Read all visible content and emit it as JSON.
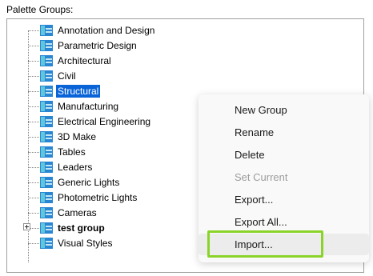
{
  "heading": "Palette Groups:",
  "tree": {
    "items": [
      {
        "label": "Annotation and Design"
      },
      {
        "label": "Parametric Design"
      },
      {
        "label": "Architectural"
      },
      {
        "label": "Civil"
      },
      {
        "label": "Structural",
        "selected": true
      },
      {
        "label": "Manufacturing"
      },
      {
        "label": "Electrical Engineering"
      },
      {
        "label": "3D Make"
      },
      {
        "label": "Tables"
      },
      {
        "label": "Leaders"
      },
      {
        "label": "Generic Lights"
      },
      {
        "label": "Photometric Lights"
      },
      {
        "label": "Cameras"
      },
      {
        "label": "test group",
        "bold": true,
        "expandable": true
      },
      {
        "label": "Visual Styles"
      }
    ]
  },
  "context_menu": {
    "items": [
      {
        "label": "New Group"
      },
      {
        "label": "Rename"
      },
      {
        "label": "Delete"
      },
      {
        "label": "Set Current",
        "disabled": true
      },
      {
        "label": "Export..."
      },
      {
        "label": "Export All..."
      },
      {
        "label": "Import...",
        "hovered": true
      }
    ]
  },
  "colors": {
    "selection": "#0a64d8",
    "highlight_outline": "#8ad32a",
    "icon_blue": "#1e8fd8",
    "icon_teal": "#39b7c8"
  },
  "icons": {
    "tree_item": "palette-icon",
    "expand": "plus-box-icon"
  }
}
